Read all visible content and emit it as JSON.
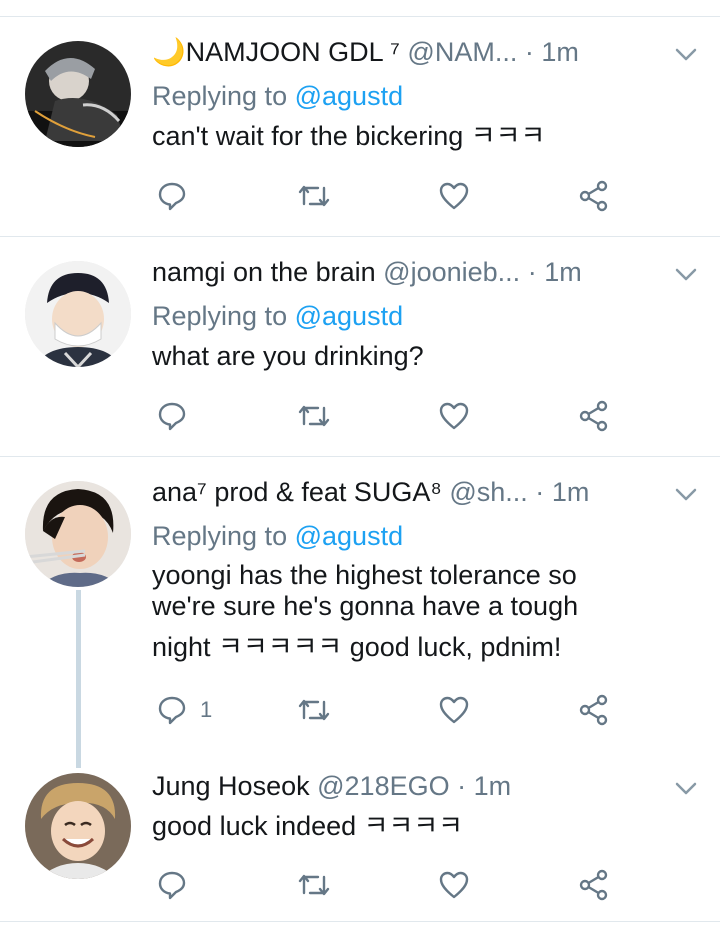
{
  "colors": {
    "accent": "#1da1f2",
    "muted": "#657786",
    "text": "#14171a",
    "divider": "#e1e8ed",
    "thread": "#c9d8e2"
  },
  "tweets": [
    {
      "name": "🌙NAMJOON GDL ⁷",
      "handle": "@NAM...",
      "separator": "·",
      "time": "1m",
      "replying_prefix": "Replying to",
      "replying_to": "@agustd",
      "text": "can't wait for the bickering ㅋㅋㅋ",
      "reply_count": ""
    },
    {
      "name": "namgi on the brain",
      "handle": "@joonieb...",
      "separator": "·",
      "time": "1m",
      "replying_prefix": "Replying to",
      "replying_to": "@agustd",
      "text": "what are you drinking?",
      "reply_count": ""
    },
    {
      "name": "ana⁷ prod & feat SUGA⁸",
      "handle": "@sh...",
      "separator": "·",
      "time": "1m",
      "replying_prefix": "Replying to",
      "replying_to": "@agustd",
      "text_lines": [
        "yoongi has the highest tolerance so",
        "we're sure he's gonna have a tough",
        "night ㅋㅋㅋㅋㅋ good luck, pdnim!"
      ],
      "reply_count": "1"
    },
    {
      "name": "Jung Hoseok",
      "handle": "@218EGO",
      "separator": "·",
      "time": "1m",
      "text": "good luck indeed ㅋㅋㅋㅋ",
      "reply_count": ""
    }
  ],
  "icons": [
    "reply-icon",
    "retweet-icon",
    "like-icon",
    "share-icon",
    "chevron-down-icon"
  ]
}
